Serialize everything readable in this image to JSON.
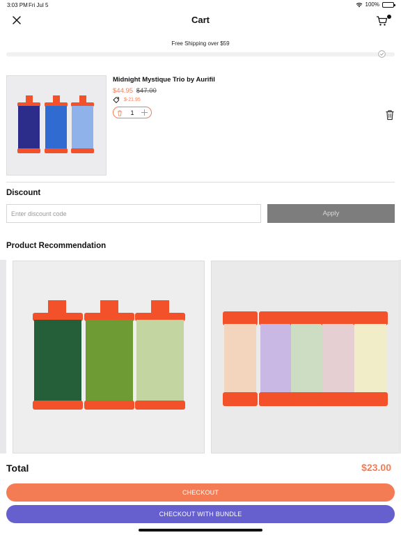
{
  "status_bar": {
    "time": "3:03 PM",
    "date": "Fri Jul 5",
    "battery": "100%"
  },
  "header": {
    "title": "Cart"
  },
  "shipping": {
    "message": "Free Shipping over $59",
    "progress_fraction": 1.0
  },
  "cart_item": {
    "name": "Midnight Mystique Trio by Aurifil",
    "sale_price": "$44.95",
    "original_price": "$47.00",
    "discount_amount": "$-21.95",
    "quantity": "1",
    "image_icon": "thread-spools-blue-image"
  },
  "discount": {
    "heading": "Discount",
    "placeholder": "Enter discount code",
    "apply_label": "Apply"
  },
  "recommendations": {
    "heading": "Product Recommendation",
    "items": [
      {
        "image_icon": "thread-spools-green-image"
      },
      {
        "image_icon": "thread-spools-pastel-image"
      }
    ]
  },
  "summary": {
    "total_label": "Total",
    "total_value": "$23.00"
  },
  "actions": {
    "checkout_label": "CHECKOUT",
    "bundle_label": "CHECKOUT WITH BUNDLE"
  },
  "colors": {
    "accent": "#f47c54",
    "bundle": "#6660cf",
    "apply_disabled": "#7d7d7d"
  }
}
